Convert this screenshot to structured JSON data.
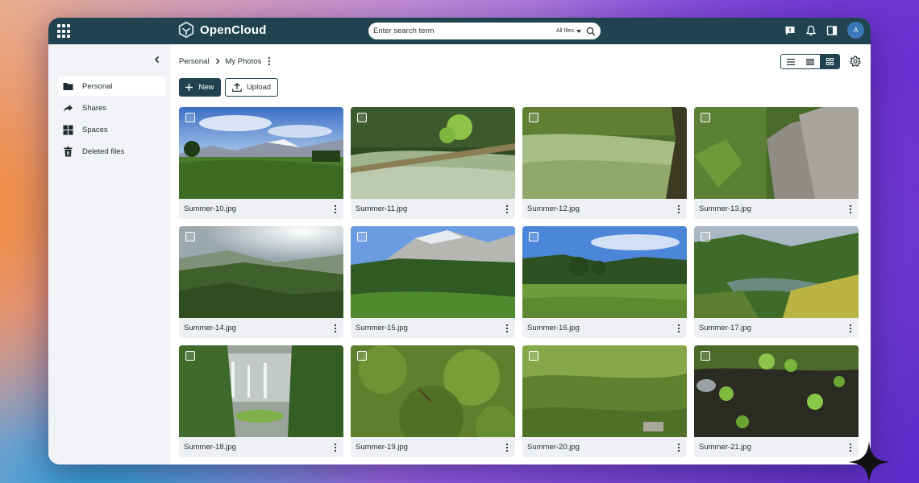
{
  "brand": {
    "name": "OpenCloud"
  },
  "search": {
    "placeholder": "Enter search term",
    "scope_label": "All files"
  },
  "user": {
    "initial": "A"
  },
  "sidebar": {
    "items": [
      {
        "label": "Personal",
        "icon": "folder-icon",
        "active": true
      },
      {
        "label": "Shares",
        "icon": "share-icon",
        "active": false
      },
      {
        "label": "Spaces",
        "icon": "spaces-icon",
        "active": false
      },
      {
        "label": "Deleted files",
        "icon": "trash-icon",
        "active": false
      }
    ]
  },
  "breadcrumb": {
    "root": "Personal",
    "current": "My Photos"
  },
  "actions": {
    "new_label": "New",
    "upload_label": "Upload"
  },
  "view_modes": {
    "selected": "tiles"
  },
  "colors": {
    "primary": "#20434f",
    "avatar": "#3a78b8"
  },
  "files": [
    {
      "name": "Summer-10.jpg"
    },
    {
      "name": "Summer-11.jpg"
    },
    {
      "name": "Summer-12.jpg"
    },
    {
      "name": "Summer-13.jpg"
    },
    {
      "name": "Summer-14.jpg"
    },
    {
      "name": "Summer-15.jpg"
    },
    {
      "name": "Summer-16.jpg"
    },
    {
      "name": "Summer-17.jpg"
    },
    {
      "name": "Summer-18.jpg"
    },
    {
      "name": "Summer-19.jpg"
    },
    {
      "name": "Summer-20.jpg"
    },
    {
      "name": "Summer-21.jpg"
    }
  ]
}
